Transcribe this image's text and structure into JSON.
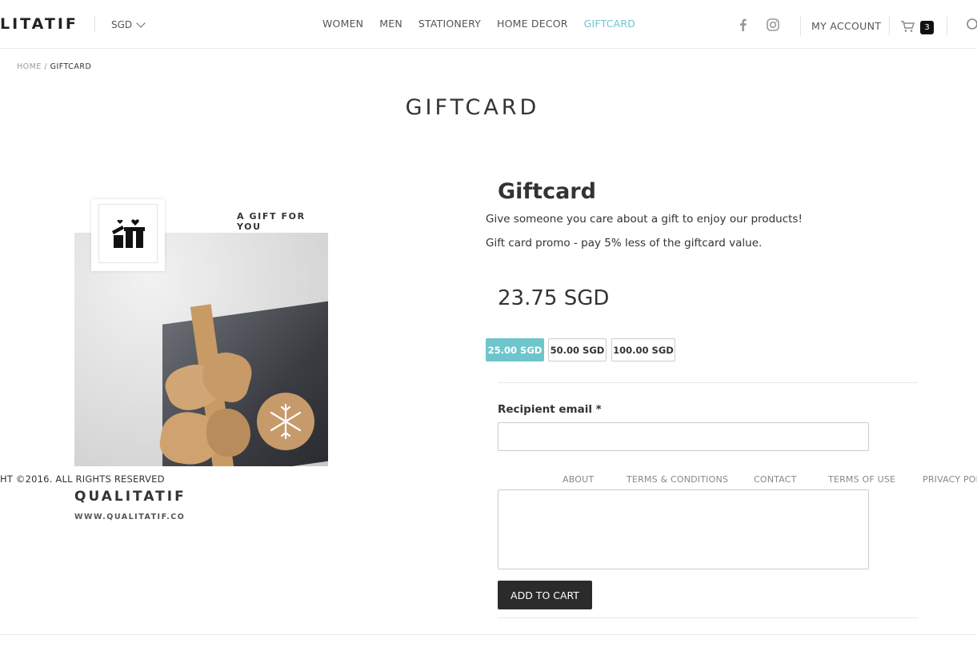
{
  "header": {
    "logo": "LITATIF",
    "currency": "SGD",
    "nav": [
      "WOMEN",
      "MEN",
      "STATIONERY",
      "HOME DECOR",
      "GIFTCARD"
    ],
    "active_nav": "GIFTCARD",
    "account": "MY ACCOUNT",
    "cart_count": "3"
  },
  "breadcrumb": {
    "home": "HOME",
    "separator": " / ",
    "current": "GIFTCARD"
  },
  "page_title": "GIFTCARD",
  "image": {
    "label": "A GIFT FOR YOU",
    "brand": "QUALITATIF",
    "url": "WWW.QUALITATIF.CO"
  },
  "product": {
    "title": "Giftcard",
    "description": "Give someone you care about a gift to enjoy our products!",
    "promo": "Gift card promo - pay 5% less of the giftcard value.",
    "price": "23.75 SGD",
    "options": [
      "25.00 SGD",
      "50.00 SGD",
      "100.00 SGD"
    ],
    "selected_option": "25.00 SGD",
    "recipient_label": "Recipient email *",
    "recipient_value": "",
    "message_value": "",
    "add_to_cart": "ADD TO CART"
  },
  "footer": {
    "copyright": "HT ©2016. ALL RIGHTS RESERVED",
    "links": [
      "ABOUT",
      "TERMS & CONDITIONS",
      "CONTACT",
      "TERMS OF USE",
      "PRIVACY POLI"
    ]
  },
  "colors": {
    "accent": "#6ec6cc",
    "button_dark": "#2b2b2b",
    "text": "#333333"
  }
}
